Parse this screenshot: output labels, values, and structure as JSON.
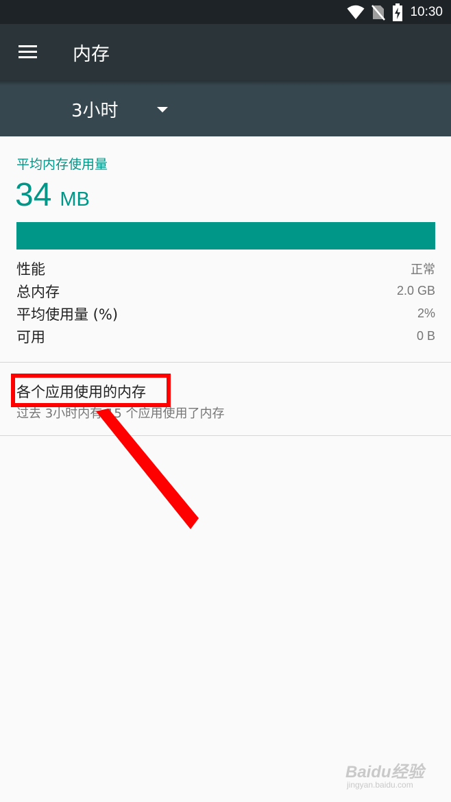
{
  "status_bar": {
    "time": "10:30",
    "icons": [
      "wifi-icon",
      "no-sim-icon",
      "battery-charging-icon"
    ]
  },
  "toolbar": {
    "title": "内存",
    "menu_icon": "menu-icon"
  },
  "time_range": {
    "selected": "3小时"
  },
  "summary": {
    "avg_label": "平均内存使用量",
    "avg_value": "34",
    "avg_unit": "MB",
    "usage_fraction": 1.0,
    "rows": [
      {
        "label": "性能",
        "value": "正常"
      },
      {
        "label": "总内存",
        "value": "2.0 GB"
      },
      {
        "label": "平均使用量 (%)",
        "value": "2%"
      },
      {
        "label": "可用",
        "value": "0 B"
      }
    ]
  },
  "apps_memory": {
    "title": "各个应用使用的内存",
    "subtitle": "过去 3小时内有 15 个应用使用了内存"
  },
  "watermark": {
    "logo": "Baidu经验",
    "url": "jingyan.baidu.com"
  },
  "colors": {
    "accent": "#009688",
    "toolbar": "#2a3439",
    "spinner_bar": "#37474f",
    "annotation": "#ff0000"
  }
}
